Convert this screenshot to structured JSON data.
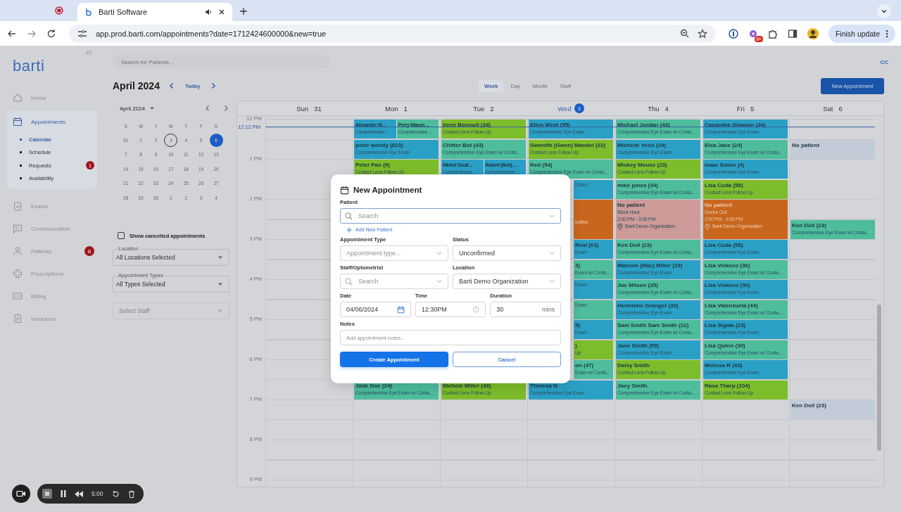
{
  "browser": {
    "tab_title": "Barti Software",
    "url": "app.prod.barti.com/appointments?date=1712424600000&new=true",
    "extension_badge": "9+",
    "update_button": "Finish update"
  },
  "sidebar": {
    "logo": "barti",
    "items": [
      {
        "label": "Home",
        "selected": false
      },
      {
        "label": "Appointments",
        "selected": true,
        "children": [
          {
            "label": "Calendar",
            "selected": true
          },
          {
            "label": "Schedule",
            "selected": false
          },
          {
            "label": "Requests",
            "selected": false,
            "badge": "1"
          },
          {
            "label": "Availability",
            "selected": false
          }
        ]
      },
      {
        "label": "Exams",
        "selected": false
      },
      {
        "label": "Communication",
        "selected": false
      },
      {
        "label": "Patients",
        "selected": false,
        "badge": "8"
      },
      {
        "label": "Prescriptions",
        "selected": false
      },
      {
        "label": "Billing",
        "selected": false
      },
      {
        "label": "Insurance",
        "selected": false
      }
    ]
  },
  "search_placeholder": "Search for Patients...",
  "avatar": "CC",
  "title": "April 2024",
  "today_button": "Today",
  "views": [
    {
      "label": "Week",
      "selected": true
    },
    {
      "label": "Day",
      "selected": false
    },
    {
      "label": "Month",
      "selected": false
    },
    {
      "label": "Staff",
      "selected": false
    }
  ],
  "new_button": "New Appointment",
  "mini_calendar": {
    "month": "April 2024",
    "weekdays": [
      "S",
      "M",
      "T",
      "W",
      "T",
      "F",
      "S"
    ],
    "weeks": [
      [
        {
          "d": "31",
          "today": false,
          "selected": false
        },
        {
          "d": "1",
          "today": false,
          "selected": false
        },
        {
          "d": "2",
          "today": false,
          "selected": false
        },
        {
          "d": "3",
          "today": true,
          "selected": false
        },
        {
          "d": "4",
          "today": false,
          "selected": false
        },
        {
          "d": "5",
          "today": false,
          "selected": false
        },
        {
          "d": "6",
          "today": false,
          "selected": true
        }
      ],
      [
        {
          "d": "7",
          "today": false,
          "selected": false
        },
        {
          "d": "8",
          "today": false,
          "selected": false
        },
        {
          "d": "9",
          "today": false,
          "selected": false
        },
        {
          "d": "10",
          "today": false,
          "selected": false
        },
        {
          "d": "11",
          "today": false,
          "selected": false
        },
        {
          "d": "12",
          "today": false,
          "selected": false
        },
        {
          "d": "13",
          "today": false,
          "selected": false
        }
      ],
      [
        {
          "d": "14",
          "today": false,
          "selected": false
        },
        {
          "d": "15",
          "today": false,
          "selected": false
        },
        {
          "d": "16",
          "today": false,
          "selected": false
        },
        {
          "d": "17",
          "today": false,
          "selected": false
        },
        {
          "d": "18",
          "today": false,
          "selected": false
        },
        {
          "d": "19",
          "today": false,
          "selected": false
        },
        {
          "d": "20",
          "today": false,
          "selected": false
        }
      ],
      [
        {
          "d": "21",
          "today": false,
          "selected": false
        },
        {
          "d": "22",
          "today": false,
          "selected": false
        },
        {
          "d": "23",
          "today": false,
          "selected": false
        },
        {
          "d": "24",
          "today": false,
          "selected": false
        },
        {
          "d": "25",
          "today": false,
          "selected": false
        },
        {
          "d": "26",
          "today": false,
          "selected": false
        },
        {
          "d": "27",
          "today": false,
          "selected": false
        }
      ],
      [
        {
          "d": "28",
          "today": false,
          "selected": false
        },
        {
          "d": "29",
          "today": false,
          "selected": false
        },
        {
          "d": "30",
          "today": false,
          "selected": false
        },
        {
          "d": "1",
          "today": false,
          "selected": false
        },
        {
          "d": "2",
          "today": false,
          "selected": false
        },
        {
          "d": "3",
          "today": false,
          "selected": false
        },
        {
          "d": "4",
          "today": false,
          "selected": false
        }
      ]
    ]
  },
  "show_cancelled": {
    "label": "Show cancelled appointments",
    "checked": false
  },
  "filters": [
    {
      "label": "Location",
      "value": "All Locations Selected"
    },
    {
      "label": "Appointment Types",
      "value": "All Types Selected"
    },
    {
      "placeholder": "Select Staff"
    }
  ],
  "calendar": {
    "now_label": "12:12 PM",
    "hours": [
      "12 PM",
      "1 PM",
      "2 PM",
      "3 PM",
      "4 PM",
      "5 PM",
      "6 PM",
      "7 PM",
      "8 PM",
      "9 PM"
    ],
    "days": [
      {
        "day": "Sun",
        "date": "31",
        "today": false
      },
      {
        "day": "Mon",
        "date": "1",
        "today": false,
        "slots": [
          {
            "kind": "appointments",
            "events": [
              {
                "name": "Alexander W...",
                "detail": "Comprehensive ...",
                "color": "#2ba0c6"
              },
              {
                "name": "Perry Mason ...",
                "detail": "Comprehensive ...",
                "color": "#4dbd9c"
              }
            ]
          },
          {
            "kind": "appointments",
            "events": [
              {
                "name": "peter wendy (823)",
                "detail": "Comprehensive Eye Exam",
                "color": "#2ba0c6"
              }
            ]
          },
          {
            "kind": "appointments",
            "events": [
              {
                "name": "Peter Pan (9)",
                "detail": "Contact Lens Follow Up",
                "color": "#7cbd2b"
              }
            ]
          },
          {
            "kind": "empty"
          },
          {
            "kind": "empty"
          },
          {
            "kind": "empty"
          },
          {
            "kind": "empty"
          },
          {
            "kind": "empty"
          },
          {
            "kind": "empty"
          },
          {
            "kind": "empty"
          },
          {
            "kind": "empty"
          },
          {
            "kind": "empty"
          },
          {
            "kind": "empty"
          },
          {
            "kind": "appointments",
            "events": [
              {
                "name": "Jade Doe (24)",
                "detail": "Comprehensive Eye Exam w/ Conta...",
                "color": "#4dbd9c"
              }
            ]
          }
        ]
      },
      {
        "day": "Tue",
        "date": "2",
        "today": false,
        "slots": [
          {
            "kind": "appointments",
            "events": [
              {
                "name": "Irene Bonnuit (34)",
                "detail": "Contact Lens Follow Up",
                "color": "#7cbd2b"
              }
            ]
          },
          {
            "kind": "appointments",
            "events": [
              {
                "name": "Chitter Bot (43)",
                "detail": "Comprehensive Eye Exam w/ Conta...",
                "color": "#4dbd9c"
              }
            ]
          },
          {
            "kind": "appointments",
            "events": [
              {
                "name": "Michel Scott ...",
                "detail": "Comprehensive ...",
                "color": "#2ba0c6"
              },
              {
                "name": "Robert (Bob) ...",
                "detail": "Comprehensive ...",
                "color": "#2ba0c6"
              }
            ]
          },
          {
            "kind": "empty"
          },
          {
            "kind": "empty"
          },
          {
            "kind": "empty"
          },
          {
            "kind": "empty"
          },
          {
            "kind": "empty"
          },
          {
            "kind": "empty"
          },
          {
            "kind": "empty"
          },
          {
            "kind": "empty"
          },
          {
            "kind": "empty"
          },
          {
            "kind": "empty"
          },
          {
            "kind": "appointments",
            "events": [
              {
                "name": "Nichole Miller (43)",
                "detail": "Contact Lens Follow Up",
                "color": "#7cbd2b"
              }
            ]
          }
        ]
      },
      {
        "day": "Wed",
        "date": "3",
        "today": true,
        "slots": [
          {
            "kind": "appointments",
            "events": [
              {
                "name": "Ellen West (55)",
                "detail": "Comprehensive Eye Exam",
                "color": "#2ba0c6"
              }
            ]
          },
          {
            "kind": "appointments",
            "events": [
              {
                "name": "Gwenith (Gwen) Mandel (22)",
                "detail": "Contact Lens Follow Up",
                "color": "#7cbd2b"
              }
            ]
          },
          {
            "kind": "appointments",
            "events": [
              {
                "name": "Red (54)",
                "detail": "Comprehensive Eye Exam w/ Conta...",
                "color": "#4dbd9c"
              }
            ]
          },
          {
            "kind": "clipped",
            "events": [
              {
                "detail": "Exam",
                "color": "#2ba0c6"
              }
            ]
          },
          {
            "kind": "clipped-block",
            "color": "#c8661e",
            "location": "ization"
          },
          {
            "kind": "clipped",
            "events": [
              {
                "name": "Real (63)",
                "detail": "Exam",
                "color": "#2ba0c6"
              }
            ]
          },
          {
            "kind": "clipped",
            "events": [
              {
                "name": "3)",
                "detail": "Exam w/ Conta...",
                "color": "#4dbd9c"
              }
            ]
          },
          {
            "kind": "clipped",
            "events": [
              {
                "detail": "Exam",
                "color": "#2ba0c6"
              }
            ]
          },
          {
            "kind": "clipped",
            "events": [
              {
                "detail": "Exam",
                "color": "#4dbd9c"
              }
            ]
          },
          {
            "kind": "clipped",
            "events": [
              {
                "name": "5)",
                "detail": "Exam",
                "color": "#2ba0c6"
              }
            ]
          },
          {
            "kind": "clipped",
            "events": [
              {
                "name": ")",
                "detail": "Up",
                "color": "#7cbd2b"
              }
            ]
          },
          {
            "kind": "clipped",
            "events": [
              {
                "name": "on (47)",
                "detail": "Exam w/ Conta...",
                "color": "#4dbd9c"
              }
            ]
          },
          {
            "kind": "appointments",
            "events": [
              {
                "name": "Theresa N",
                "detail": "Comprehensive Eye Exam",
                "color": "#2ba0c6"
              }
            ]
          }
        ]
      },
      {
        "day": "Thu",
        "date": "4",
        "today": false,
        "slots": [
          {
            "kind": "appointments",
            "events": [
              {
                "name": "Michael Jordan (43)",
                "detail": "Comprehensive Eye Exam w/ Conta...",
                "color": "#4dbd9c"
              }
            ]
          },
          {
            "kind": "appointments",
            "events": [
              {
                "name": "Michelle Yeoh (24)",
                "detail": "Comprehensive Eye Exam",
                "color": "#2ba0c6"
              }
            ]
          },
          {
            "kind": "appointments",
            "events": [
              {
                "name": "Mickey Mouse (23)",
                "detail": "Contact Lens Follow Up",
                "color": "#7cbd2b"
              }
            ]
          },
          {
            "kind": "appointments",
            "events": [
              {
                "name": "mike jones (34)",
                "detail": "Comprehensive Eye Exam w/ Conta...",
                "color": "#4dbd9c"
              }
            ]
          },
          {
            "kind": "block",
            "color": "#cd9a98",
            "title": "No patient",
            "reason": "Block Hour",
            "time": "2:00 PM - 3:00 PM",
            "location": "Barti Demo Organization"
          },
          {
            "kind": "appointments",
            "events": [
              {
                "name": "Ken Doll (23)",
                "detail": "Comprehensive Eye Exam w/ Conta...",
                "color": "#4dbd9c"
              }
            ]
          },
          {
            "kind": "appointments",
            "events": [
              {
                "name": "Malcom (Mac) Miller (23)",
                "detail": "Comprehensive Eye Exam",
                "color": "#2ba0c6"
              }
            ]
          },
          {
            "kind": "appointments",
            "events": [
              {
                "name": "Joe Milson (35)",
                "detail": "Comprehensive Eye Exam w/ Conta...",
                "color": "#4dbd9c"
              }
            ]
          },
          {
            "kind": "appointments",
            "events": [
              {
                "name": "Hermione Granger (33)",
                "detail": "Comprehensive Eye Exam",
                "color": "#2ba0c6"
              }
            ]
          },
          {
            "kind": "appointments",
            "events": [
              {
                "name": "Sam Smith Sam Smith (22)",
                "detail": "Comprehensive Eye Exam w/ Conta...",
                "color": "#4dbd9c"
              }
            ]
          },
          {
            "kind": "appointments",
            "events": [
              {
                "name": "Jane Smith (59)",
                "detail": "Comprehensive Eye Exam",
                "color": "#2ba0c6"
              }
            ]
          },
          {
            "kind": "appointments",
            "events": [
              {
                "name": "Daisy Smith",
                "detail": "Contact Lens Follow Up",
                "color": "#7cbd2b"
              }
            ]
          },
          {
            "kind": "appointments",
            "events": [
              {
                "name": "Joey Smith",
                "detail": "Comprehensive Eye Exam w/ Conta...",
                "color": "#4dbd9c"
              }
            ]
          }
        ]
      },
      {
        "day": "Fri",
        "date": "5",
        "today": false,
        "slots": [
          {
            "kind": "appointments",
            "events": [
              {
                "name": "Casandra Gleason (24)",
                "detail": "Comprehensive Eye Exam",
                "color": "#2ba0c6"
              }
            ]
          },
          {
            "kind": "appointments",
            "events": [
              {
                "name": "Elsa Jane (24)",
                "detail": "Comprehensive Eye Exam w/ Conta...",
                "color": "#4dbd9c"
              }
            ]
          },
          {
            "kind": "appointments",
            "events": [
              {
                "name": "Isaac Eaton (4)",
                "detail": "Comprehensive Eye Exam",
                "color": "#2ba0c6"
              }
            ]
          },
          {
            "kind": "appointments",
            "events": [
              {
                "name": "Lisa Cuda (58)",
                "detail": "Contact Lens Follow Up",
                "color": "#7cbd2b"
              }
            ]
          },
          {
            "kind": "block",
            "color": "#c8661e",
            "title": "No patient",
            "reason": "Doctor Out",
            "time": "2:00 PM - 3:00 PM",
            "location": "Barti Demo Organization"
          },
          {
            "kind": "appointments",
            "events": [
              {
                "name": "Lisa Cuda (58)",
                "detail": "Comprehensive Eye Exam",
                "color": "#2ba0c6"
              }
            ]
          },
          {
            "kind": "appointments",
            "events": [
              {
                "name": "Lisa Velasco (36)",
                "detail": "Comprehensive Eye Exam w/ Conta...",
                "color": "#4dbd9c"
              }
            ]
          },
          {
            "kind": "appointments",
            "events": [
              {
                "name": "Lisa Velasco (36)",
                "detail": "Comprehensive Eye Exam",
                "color": "#2ba0c6"
              }
            ]
          },
          {
            "kind": "appointments",
            "events": [
              {
                "name": "Lisa Valenzuela (44)",
                "detail": "Comprehensive Eye Exam w/ Conta...",
                "color": "#4dbd9c"
              }
            ]
          },
          {
            "kind": "appointments",
            "events": [
              {
                "name": "Lisa Sigala (23)",
                "detail": "Comprehensive Eye Exam",
                "color": "#2ba0c6"
              }
            ]
          },
          {
            "kind": "appointments",
            "events": [
              {
                "name": "Lisa Quinn (30)",
                "detail": "Comprehensive Eye Exam w/ Conta...",
                "color": "#4dbd9c"
              }
            ]
          },
          {
            "kind": "appointments",
            "events": [
              {
                "name": "Melissa R (43)",
                "detail": "Comprehensive Eye Exam",
                "color": "#2ba0c6"
              }
            ]
          },
          {
            "kind": "appointments",
            "events": [
              {
                "name": "Rasa Tharp (104)",
                "detail": "Contact Lens Follow Up",
                "color": "#7cbd2b"
              }
            ]
          }
        ]
      },
      {
        "day": "Sat",
        "date": "6",
        "today": false,
        "slots": [
          {
            "kind": "empty"
          },
          {
            "kind": "appointments",
            "events": [
              {
                "name": "No patient",
                "color": "#c3cad8"
              }
            ]
          },
          {
            "kind": "empty"
          },
          {
            "kind": "empty"
          },
          {
            "kind": "empty"
          },
          {
            "kind": "appointments",
            "events": [
              {
                "name": "Ken Doll (23)",
                "detail": "Comprehensive Eye Exam w/ Conta...",
                "color": "#4dbd9c"
              }
            ]
          },
          {
            "kind": "empty"
          },
          {
            "kind": "empty"
          },
          {
            "kind": "empty"
          },
          {
            "kind": "empty"
          },
          {
            "kind": "empty"
          },
          {
            "kind": "empty"
          },
          {
            "kind": "empty"
          },
          {
            "kind": "empty"
          },
          {
            "kind": "appointments",
            "events": [
              {
                "name": "Ken Doll (23)",
                "color": "#c3cad8"
              }
            ]
          }
        ]
      }
    ]
  },
  "modal": {
    "title": "New Appointment",
    "patient": {
      "label": "Patient",
      "placeholder": "Search"
    },
    "add_patient": "Add New Patient",
    "appointment_type": {
      "label": "Appointment Type",
      "placeholder": "Appointment type..."
    },
    "status": {
      "label": "Status",
      "value": "Unconfirmed"
    },
    "staff": {
      "label": "Staff/Optometrist",
      "placeholder": "Search"
    },
    "location": {
      "label": "Location",
      "value": "Barti Demo Organization"
    },
    "date": {
      "label": "Date",
      "value": "04/06/2024"
    },
    "time": {
      "label": "Time",
      "value": "12:30PM"
    },
    "duration": {
      "label": "Duration",
      "value": "30",
      "unit": "mins"
    },
    "notes": {
      "label": "Notes",
      "placeholder": "Add appointment notes..."
    },
    "buttons": [
      {
        "label": "Create Appointment",
        "kind": "primary"
      },
      {
        "label": "Cancel",
        "kind": "secondary"
      }
    ]
  },
  "recorder": {
    "time": "5:00"
  }
}
